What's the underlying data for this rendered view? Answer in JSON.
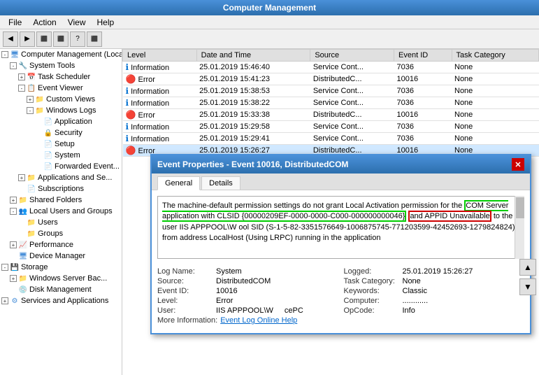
{
  "titleBar": {
    "label": "Computer Management"
  },
  "menuBar": {
    "items": [
      {
        "id": "file",
        "label": "File"
      },
      {
        "id": "action",
        "label": "Action"
      },
      {
        "id": "view",
        "label": "View"
      },
      {
        "id": "help",
        "label": "Help"
      }
    ]
  },
  "toolbar": {
    "buttons": [
      "◀",
      "▶",
      "⬛",
      "⬛",
      "?",
      "⬛"
    ]
  },
  "treePanel": {
    "items": [
      {
        "id": "computer-mgmt",
        "label": "Computer Management (Local",
        "indent": 0,
        "icon": "🖥",
        "expand": "-"
      },
      {
        "id": "system-tools",
        "label": "System Tools",
        "indent": 1,
        "icon": "🔧",
        "expand": "-"
      },
      {
        "id": "task-scheduler",
        "label": "Task Scheduler",
        "indent": 2,
        "icon": "📅",
        "expand": "+"
      },
      {
        "id": "event-viewer",
        "label": "Event Viewer",
        "indent": 2,
        "icon": "📋",
        "expand": "-"
      },
      {
        "id": "custom-views",
        "label": "Custom Views",
        "indent": 3,
        "icon": "📁",
        "expand": "+"
      },
      {
        "id": "windows-logs",
        "label": "Windows Logs",
        "indent": 3,
        "icon": "📁",
        "expand": "-"
      },
      {
        "id": "application",
        "label": "Application",
        "indent": 4,
        "icon": "📄",
        "expand": ""
      },
      {
        "id": "security",
        "label": "Security",
        "indent": 4,
        "icon": "📄",
        "expand": ""
      },
      {
        "id": "setup",
        "label": "Setup",
        "indent": 4,
        "icon": "📄",
        "expand": ""
      },
      {
        "id": "system",
        "label": "System",
        "indent": 4,
        "icon": "📄",
        "expand": ""
      },
      {
        "id": "forwarded-events",
        "label": "Forwarded Event...",
        "indent": 4,
        "icon": "📄",
        "expand": ""
      },
      {
        "id": "apps-services",
        "label": "Applications and Se...",
        "indent": 2,
        "icon": "📁",
        "expand": "+"
      },
      {
        "id": "subscriptions",
        "label": "Subscriptions",
        "indent": 2,
        "icon": "📄",
        "expand": ""
      },
      {
        "id": "shared-folders",
        "label": "Shared Folders",
        "indent": 1,
        "icon": "📁",
        "expand": "+"
      },
      {
        "id": "local-users",
        "label": "Local Users and Groups",
        "indent": 1,
        "icon": "👥",
        "expand": "-"
      },
      {
        "id": "users",
        "label": "Users",
        "indent": 2,
        "icon": "📁",
        "expand": ""
      },
      {
        "id": "groups",
        "label": "Groups",
        "indent": 2,
        "icon": "📁",
        "expand": ""
      },
      {
        "id": "performance",
        "label": "Performance",
        "indent": 1,
        "icon": "📈",
        "expand": "+"
      },
      {
        "id": "device-manager",
        "label": "Device Manager",
        "indent": 1,
        "icon": "🖥",
        "expand": ""
      },
      {
        "id": "storage",
        "label": "Storage",
        "indent": 0,
        "icon": "💾",
        "expand": "-"
      },
      {
        "id": "win-server-backup",
        "label": "Windows Server Bac...",
        "indent": 1,
        "icon": "📁",
        "expand": "+"
      },
      {
        "id": "disk-management",
        "label": "Disk Management",
        "indent": 1,
        "icon": "💿",
        "expand": ""
      },
      {
        "id": "services-apps",
        "label": "Services and Applications",
        "indent": 0,
        "icon": "⚙",
        "expand": "+"
      }
    ]
  },
  "eventTable": {
    "columns": [
      "Level",
      "Date and Time",
      "Source",
      "Event ID",
      "Task Category"
    ],
    "rows": [
      {
        "level": "Information",
        "levelType": "info",
        "datetime": "25.01.2019 15:46:40",
        "source": "Service Cont...",
        "eventId": "7036",
        "category": "None"
      },
      {
        "level": "Error",
        "levelType": "error",
        "datetime": "25.01.2019 15:41:23",
        "source": "DistributedC...",
        "eventId": "10016",
        "category": "None"
      },
      {
        "level": "Information",
        "levelType": "info",
        "datetime": "25.01.2019 15:38:53",
        "source": "Service Cont...",
        "eventId": "7036",
        "category": "None"
      },
      {
        "level": "Information",
        "levelType": "info",
        "datetime": "25.01.2019 15:38:22",
        "source": "Service Cont...",
        "eventId": "7036",
        "category": "None"
      },
      {
        "level": "Error",
        "levelType": "error",
        "datetime": "25.01.2019 15:33:38",
        "source": "DistributedC...",
        "eventId": "10016",
        "category": "None"
      },
      {
        "level": "Information",
        "levelType": "info",
        "datetime": "25.01.2019 15:29:58",
        "source": "Service Cont...",
        "eventId": "7036",
        "category": "None"
      },
      {
        "level": "Information",
        "levelType": "info",
        "datetime": "25.01.2019 15:29:41",
        "source": "Service Cont...",
        "eventId": "7036",
        "category": "None"
      },
      {
        "level": "Error",
        "levelType": "error",
        "datetime": "25.01.2019 15:26:27",
        "source": "DistributedC...",
        "eventId": "10016",
        "category": "None"
      }
    ]
  },
  "eventDialog": {
    "title": "Event Properties - Event 10016, DistributedCOM",
    "tabs": [
      "General",
      "Details"
    ],
    "activeTab": "General",
    "message": "The machine-default permission settings do not grant Local Activation permission for the COM Server application with CLSID {00000209EF-0000-0000-C000-000000000046} and APPID Unavailable to the user IIS APPPOOL\\W     ool SID (S-1-5-82-3351576649-1006875745-771203599-42452693-1279824824) from address LocalHost (Using LRPC) running in the application",
    "logName": "System",
    "source": "DistributedCOM",
    "eventId": "10016",
    "level": "Error",
    "user": "IIS APPPOOL\\W",
    "opCode": "Info",
    "logged": "25.01.2019 15:26:27",
    "taskCategory": "None",
    "keywords": "Classic",
    "computer": "............",
    "moreInfo": "Event Log Online Help",
    "scrollButtons": [
      "▲",
      "▼"
    ],
    "clsidHighlight": "{00000209EF-0000-0000-C000-000000000046}",
    "appidHighlight": "and APPID Unavailable"
  }
}
